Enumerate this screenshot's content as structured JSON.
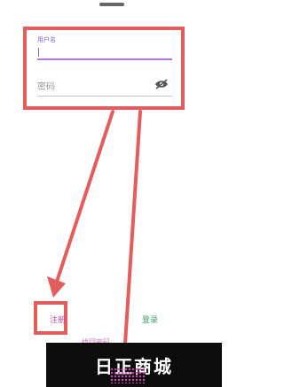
{
  "form": {
    "username_label": "用户名",
    "password_placeholder": "密码"
  },
  "actions": {
    "register_label": "注册",
    "login_label": "登录",
    "forgot_label": "找回密码"
  },
  "watermark": {
    "text": "日正商城"
  },
  "colors": {
    "highlight": "#e35d5d",
    "accent": "#8a5ec6",
    "register": "#c24a9b",
    "login": "#3f9b6f"
  },
  "icons": [
    "eye-off-icon"
  ]
}
